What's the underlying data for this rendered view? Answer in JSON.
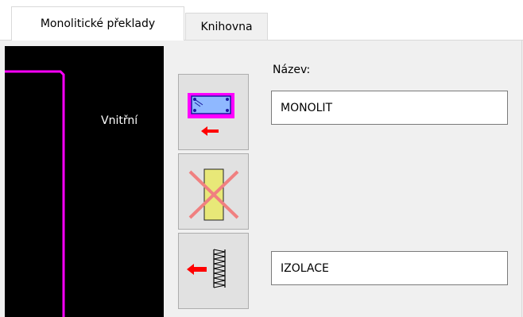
{
  "tabs": [
    {
      "label": "Monolitické překlady",
      "active": true
    },
    {
      "label": "Knihovna",
      "active": false
    }
  ],
  "preview": {
    "label": "Vnitřní",
    "background": "#000000",
    "line_color": "#ff00ff"
  },
  "buttons": [
    {
      "name": "monolith-lintel-button",
      "icon": "magenta-lintel-with-red-arrow-icon"
    },
    {
      "name": "no-insulation-button",
      "icon": "yellow-block-crossed-icon"
    },
    {
      "name": "insulation-button",
      "icon": "red-arrow-with-hatched-column-icon"
    }
  ],
  "form": {
    "nazev_label": "Název:",
    "nazev_value": "MONOLIT",
    "izolace_value": "IZOLACE"
  },
  "colors": {
    "accent_magenta": "#ff00ff",
    "arrow_red": "#ff0000",
    "block_yellow": "#e8e878"
  }
}
